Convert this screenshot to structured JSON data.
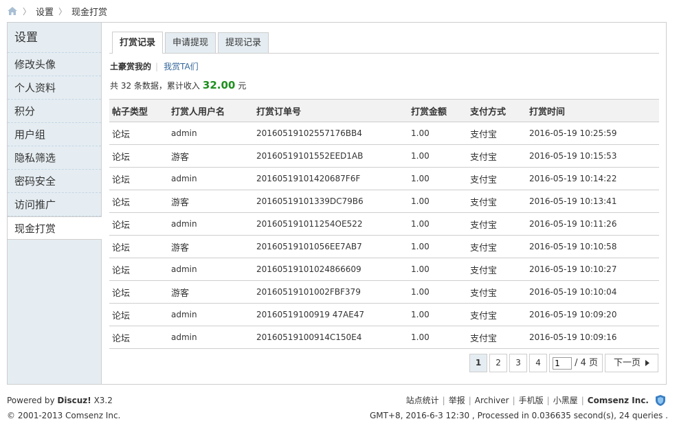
{
  "breadcrumb": {
    "items": [
      "设置",
      "现金打赏"
    ]
  },
  "sidebar": {
    "title": "设置",
    "items": [
      {
        "label": "修改头像"
      },
      {
        "label": "个人资料"
      },
      {
        "label": "积分"
      },
      {
        "label": "用户组"
      },
      {
        "label": "隐私筛选"
      },
      {
        "label": "密码安全"
      },
      {
        "label": "访问推广"
      },
      {
        "label": "现金打赏"
      }
    ]
  },
  "tabs": [
    "打赏记录",
    "申请提现",
    "提现记录"
  ],
  "subtabs": {
    "current": "土豪赏我的",
    "separator": "|",
    "other": "我赏TA们"
  },
  "summary": {
    "prefix": "共 32 条数据，累计收入",
    "amount": "32.00",
    "unit": "元"
  },
  "table": {
    "headers": [
      "帖子类型",
      "打赏人用户名",
      "打赏订单号",
      "打赏金额",
      "支付方式",
      "打赏时间"
    ],
    "rows": [
      [
        "论坛",
        "admin",
        "20160519102557176BB4",
        "1.00",
        "支付宝",
        "2016-05-19 10:25:59"
      ],
      [
        "论坛",
        "游客",
        "20160519101552EED1AB",
        "1.00",
        "支付宝",
        "2016-05-19 10:15:53"
      ],
      [
        "论坛",
        "admin",
        "20160519101420687F6F",
        "1.00",
        "支付宝",
        "2016-05-19 10:14:22"
      ],
      [
        "论坛",
        "游客",
        "20160519101339DC79B6",
        "1.00",
        "支付宝",
        "2016-05-19 10:13:41"
      ],
      [
        "论坛",
        "admin",
        "201605191011254OE522",
        "1.00",
        "支付宝",
        "2016-05-19 10:11:26"
      ],
      [
        "论坛",
        "游客",
        "20160519101056EE7AB7",
        "1.00",
        "支付宝",
        "2016-05-19 10:10:58"
      ],
      [
        "论坛",
        "admin",
        "20160519101024866609",
        "1.00",
        "支付宝",
        "2016-05-19 10:10:27"
      ],
      [
        "论坛",
        "游客",
        "20160519101002FBF379",
        "1.00",
        "支付宝",
        "2016-05-19 10:10:04"
      ],
      [
        "论坛",
        "admin",
        "20160519100919 47AE47",
        "1.00",
        "支付宝",
        "2016-05-19 10:09:20"
      ],
      [
        "论坛",
        "admin",
        "20160519100914C150E4",
        "1.00",
        "支付宝",
        "2016-05-19 10:09:16"
      ]
    ]
  },
  "pagination": {
    "pages": [
      "1",
      "2",
      "3",
      "4"
    ],
    "current": "1",
    "input_value": "1",
    "total_label": "/ 4 页",
    "next_label": "下一页"
  },
  "footer": {
    "powered_prefix": "Powered by",
    "powered_brand": "Discuz!",
    "powered_version": "X3.2",
    "copyright": "© 2001-2013 Comsenz Inc.",
    "links": [
      "站点统计",
      "举报",
      "Archiver",
      "手机版",
      "小黑屋"
    ],
    "company": "Comsenz Inc.",
    "stats": "GMT+8, 2016-6-3 12:30 , Processed in 0.036635 second(s), 24 queries ."
  },
  "colors": {
    "sidebar_bg": "#e5edf2",
    "link": "#336699",
    "amount": "#1e8f1e",
    "border": "#cdcdcd"
  },
  "icons": {
    "home": "home-icon",
    "badge": "shield-icon",
    "next": "chevron-right-icon"
  }
}
